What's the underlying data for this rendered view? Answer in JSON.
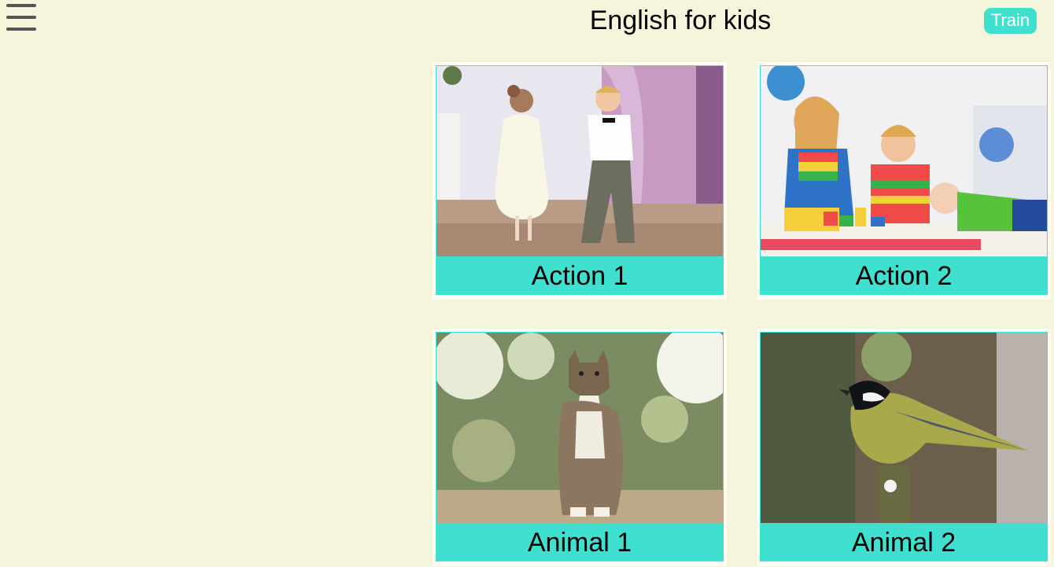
{
  "header": {
    "title": "English for kids",
    "menu_icon": "hamburger-icon",
    "mode_toggle_label": "Train"
  },
  "colors": {
    "background": "#f5f5dc",
    "accent": "#40e0d0",
    "menu_icon": "#555555"
  },
  "categories": [
    {
      "label": "Action 1",
      "image": "children-dancing-photo"
    },
    {
      "label": "Action 2",
      "image": "children-playing-blocks-photo"
    },
    {
      "label": "Animal 1",
      "image": "cat-photo"
    },
    {
      "label": "Animal 2",
      "image": "bird-photo"
    }
  ]
}
